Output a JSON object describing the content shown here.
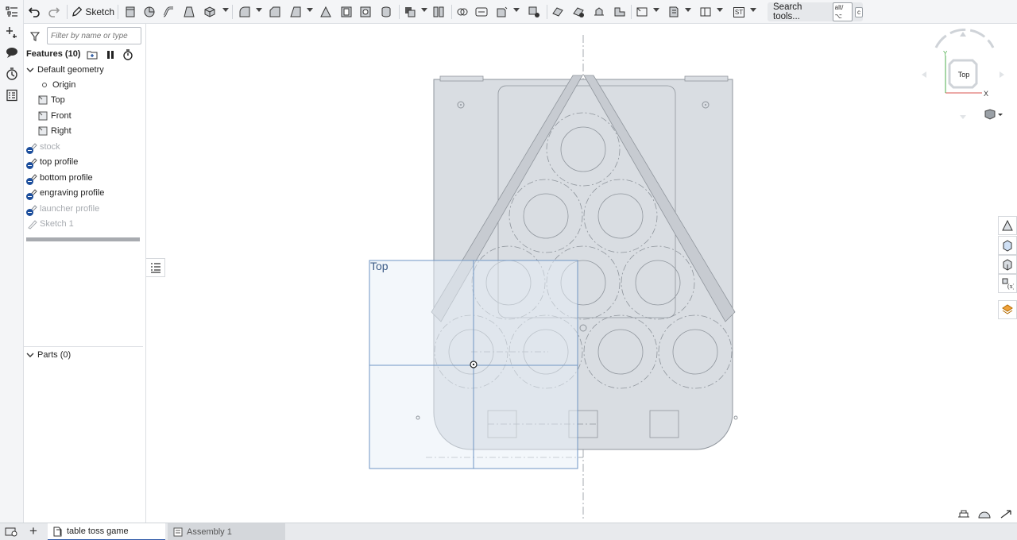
{
  "toolbar": {
    "sketch_label": "Sketch",
    "st_label": "ST",
    "search": {
      "label": "Search tools...",
      "shortcut_mod": "alt/⌥",
      "shortcut_key": "c"
    }
  },
  "feature_panel": {
    "filter_placeholder": "Filter by name or type",
    "title": "Features (10)",
    "default_geometry_label": "Default geometry",
    "items": [
      {
        "label": "Origin",
        "kind": "origin",
        "dim": false
      },
      {
        "label": "Top",
        "kind": "plane",
        "dim": false
      },
      {
        "label": "Front",
        "kind": "plane",
        "dim": false
      },
      {
        "label": "Right",
        "kind": "plane",
        "dim": false
      },
      {
        "label": "stock",
        "kind": "sketch-hidden",
        "dim": true
      },
      {
        "label": "top profile",
        "kind": "sketch-hidden",
        "dim": false
      },
      {
        "label": "bottom profile",
        "kind": "sketch-hidden",
        "dim": false
      },
      {
        "label": "engraving profile",
        "kind": "sketch-hidden",
        "dim": false
      },
      {
        "label": "launcher profile",
        "kind": "sketch-hidden",
        "dim": true
      },
      {
        "label": "Sketch 1",
        "kind": "sketch",
        "dim": true
      }
    ],
    "parts_label": "Parts (0)"
  },
  "canvas": {
    "plane_label": "Top"
  },
  "view_cube": {
    "face_label": "Top",
    "y_axis": "Y",
    "x_axis": "X"
  },
  "tabs": [
    {
      "label": "table toss game",
      "active": true,
      "icon": "part-studio-icon"
    },
    {
      "label": "Assembly 1",
      "active": false,
      "icon": "assembly-icon"
    }
  ],
  "colors": {
    "accent": "#2f5aa8",
    "part_fill": "#d9dde2",
    "sketch_line": "#8f959c",
    "plane_fill": "#e8f0f8",
    "plane_stroke": "#6f95c4"
  }
}
